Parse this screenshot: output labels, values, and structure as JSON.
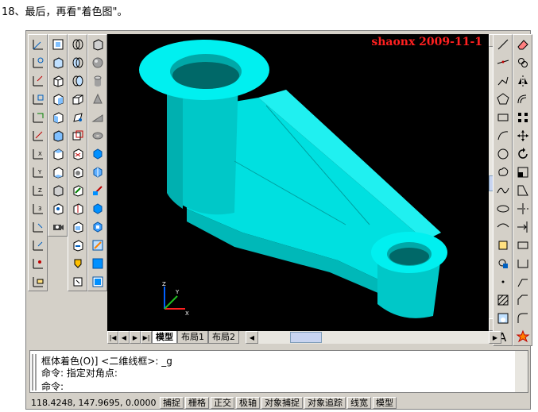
{
  "caption": "18、最后，再看\"着色图\"。",
  "watermark": "shaonx 2009-11-1",
  "tabs": [
    "模型",
    "布局1",
    "布局2"
  ],
  "command_lines": [
    "框体着色(O)] <二维线框>: _g",
    "命令: 指定对角点:",
    "命令:"
  ],
  "coordinates": "118.4248, 147.9695, 0.0000",
  "status_buttons": [
    "捕捉",
    "栅格",
    "正交",
    "极轴",
    "对象捕捉",
    "对象追踪",
    "线宽",
    "模型"
  ],
  "colors": {
    "model": "#00e8e8",
    "watermark": "#ff2020"
  },
  "icons": [
    "ucs-icon",
    "view-icon",
    "orbit-icon",
    "solid-icon",
    "shade-icon",
    "draw-icon",
    "modify-icon"
  ]
}
